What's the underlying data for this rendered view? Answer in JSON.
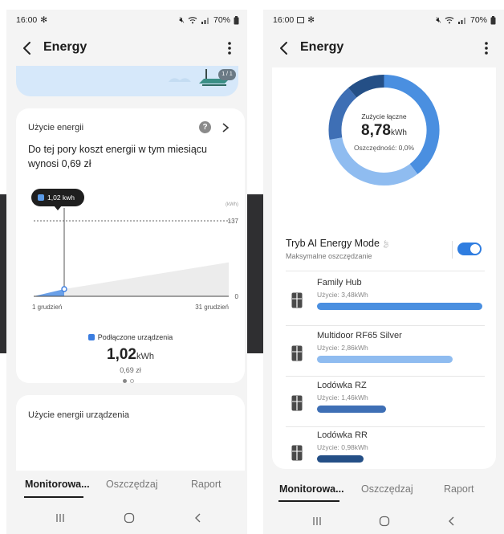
{
  "status_bar": {
    "time": "16:00",
    "battery": "70%"
  },
  "left_screen": {
    "title": "Energy",
    "banner_badge": "1 / 1",
    "energy_card": {
      "heading": "Użycie energii",
      "description": "Do tej pory koszt energii w tym miesiącu wynosi 0,69 zł",
      "tooltip": "1,02 kwh",
      "unit_label": "(kWh)",
      "y_max_label": "137",
      "y_min_label": "0",
      "x_start_label": "1 grudzień",
      "x_end_label": "31 grudzień",
      "legend_label": "Podłączone urządzenia",
      "value": "1,02",
      "value_unit": "kWh",
      "cost": "0,69 zł"
    },
    "device_card_heading": "Użycie energii urządzenia",
    "tabs": [
      "Monitorowa...",
      "Oszczędzaj",
      "Raport"
    ]
  },
  "right_screen": {
    "title": "Energy",
    "donut": {
      "label": "Zużycie łączne",
      "value": "8,78",
      "unit": "kWh",
      "savings": "Oszczędność: 0,0%"
    },
    "ai_mode": {
      "title": "Tryb AI Energy Mode",
      "subtitle": "Maksymalne oszczędzanie",
      "enabled": true
    },
    "devices": [
      {
        "name": "Family Hub",
        "usage": "Użycie: 3,48kWh",
        "kwh": 3.48,
        "color": "#4a8fe0"
      },
      {
        "name": "Multidoor RF65 Silver",
        "usage": "Użycie: 2,86kWh",
        "kwh": 2.86,
        "color": "#8fbcf0"
      },
      {
        "name": "Lodówka RZ",
        "usage": "Użycie: 1,46kWh",
        "kwh": 1.46,
        "color": "#3e6fb5"
      },
      {
        "name": "Lodówka RR",
        "usage": "Użycie: 0,98kWh",
        "kwh": 0.98,
        "color": "#244f86"
      }
    ],
    "tabs": [
      "Monitorowa...",
      "Oszczędzaj",
      "Raport"
    ]
  },
  "chart_data": {
    "type": "area",
    "x": [
      "1 grudzień",
      "31 grudzień"
    ],
    "series": [
      {
        "name": "Podłączone urządzenia",
        "values": [
          0.0,
          1.02
        ]
      }
    ],
    "xlabel": "",
    "ylabel": "(kWh)",
    "ylim": [
      0,
      137
    ],
    "reference_line": 137,
    "grid": false
  }
}
